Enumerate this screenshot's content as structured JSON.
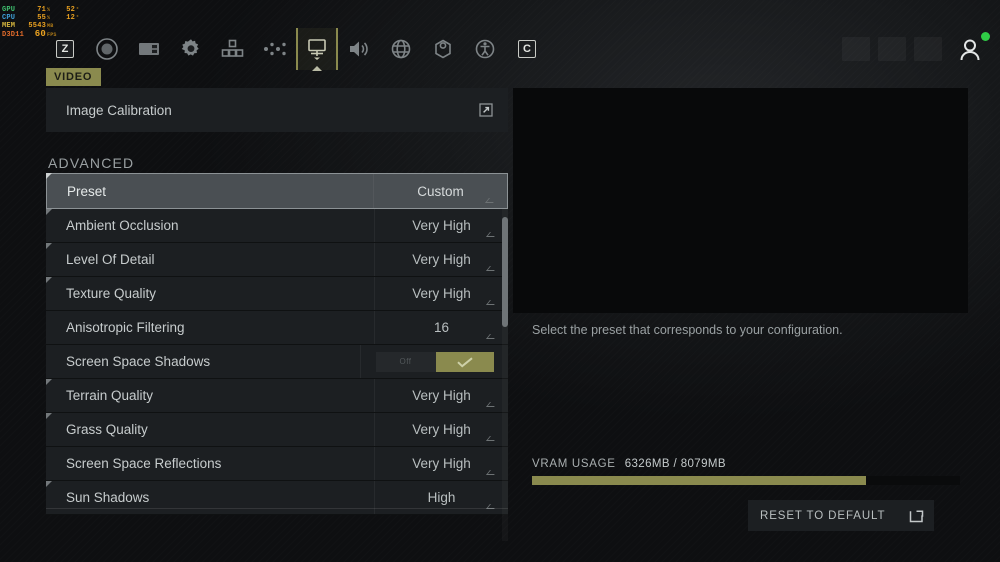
{
  "perf_overlay": {
    "rows": [
      {
        "label": "GPU",
        "value": "71",
        "unit": "%",
        "value2": "52",
        "unit2": "°"
      },
      {
        "label": "CPU",
        "value": "55",
        "unit": "%",
        "value2": "12",
        "unit2": "°"
      },
      {
        "label": "MEM",
        "value": "5543",
        "unit": "MB",
        "value2": "",
        "unit2": ""
      },
      {
        "label": "D3D11",
        "value": "60",
        "unit": "FPS",
        "value2": "",
        "unit2": ""
      }
    ]
  },
  "topbar": {
    "tabs": [
      {
        "name": "tab-keybind-z",
        "icon": "key-z-icon",
        "label": "Z",
        "active": false
      },
      {
        "name": "tab-gameplay",
        "icon": "joystick-icon",
        "label": "Gameplay",
        "active": false
      },
      {
        "name": "tab-interface",
        "icon": "display-card-icon",
        "label": "Interface",
        "active": false
      },
      {
        "name": "tab-settings",
        "icon": "gear-icon",
        "label": "Settings",
        "active": false
      },
      {
        "name": "tab-controls",
        "icon": "grid-blocks-icon",
        "label": "Controls",
        "active": false
      },
      {
        "name": "tab-keybindings",
        "icon": "dots-spread-icon",
        "label": "Key Bindings",
        "active": false
      },
      {
        "name": "tab-video",
        "icon": "monitor-icon",
        "label": "Video",
        "active": true
      },
      {
        "name": "tab-audio",
        "icon": "speaker-icon",
        "label": "Audio",
        "active": false
      },
      {
        "name": "tab-language",
        "icon": "globe-icon",
        "label": "Language",
        "active": false
      },
      {
        "name": "tab-network",
        "icon": "hexagon-icon",
        "label": "Network",
        "active": false
      },
      {
        "name": "tab-accessibility",
        "icon": "accessibility-icon",
        "label": "Accessibility",
        "active": false
      },
      {
        "name": "tab-keybind-c",
        "icon": "key-c-icon",
        "label": "C",
        "active": false
      }
    ],
    "placeholders": [
      "",
      "",
      ""
    ],
    "avatar_icon": "user-avatar-icon",
    "status": "online"
  },
  "category_badge": "VIDEO",
  "image_calibration": {
    "label": "Image Calibration",
    "icon": "external-link-icon"
  },
  "advanced": {
    "section_title": "ADVANCED",
    "rows": [
      {
        "label": "Preset",
        "value": "Custom",
        "type": "dropdown",
        "selected": true
      },
      {
        "label": "Ambient Occlusion",
        "value": "Very High",
        "type": "dropdown",
        "selected": false
      },
      {
        "label": "Level Of Detail",
        "value": "Very High",
        "type": "dropdown",
        "selected": false
      },
      {
        "label": "Texture Quality",
        "value": "Very High",
        "type": "dropdown",
        "selected": false
      },
      {
        "label": "Anisotropic Filtering",
        "value": "16",
        "type": "dropdown",
        "selected": false
      },
      {
        "label": "Screen Space Shadows",
        "value": "On",
        "type": "toggle",
        "selected": false,
        "toggle_on": true,
        "off_label": "Off"
      },
      {
        "label": "Terrain Quality",
        "value": "Very High",
        "type": "dropdown",
        "selected": false
      },
      {
        "label": "Grass Quality",
        "value": "Very High",
        "type": "dropdown",
        "selected": false
      },
      {
        "label": "Screen Space Reflections",
        "value": "Very High",
        "type": "dropdown",
        "selected": false
      },
      {
        "label": "Sun Shadows",
        "value": "High",
        "type": "dropdown",
        "selected": false
      }
    ]
  },
  "description": "Select the preset that corresponds to your configuration.",
  "vram": {
    "label": "VRAM USAGE",
    "value": "6326MB / 8079MB",
    "used_mb": 6326,
    "total_mb": 8079,
    "percent": 78,
    "bar_color": "#8a8a4e"
  },
  "reset_button": {
    "label": "RESET TO DEFAULT",
    "icon": "reset-arrow-icon"
  },
  "colors": {
    "accent": "#8a8a4e",
    "panel": "#1c1f22",
    "selected_row": "#4a4f53",
    "status_online": "#2fcc46",
    "text_primary": "#c7cccd",
    "text_muted": "#9aa0a2"
  }
}
